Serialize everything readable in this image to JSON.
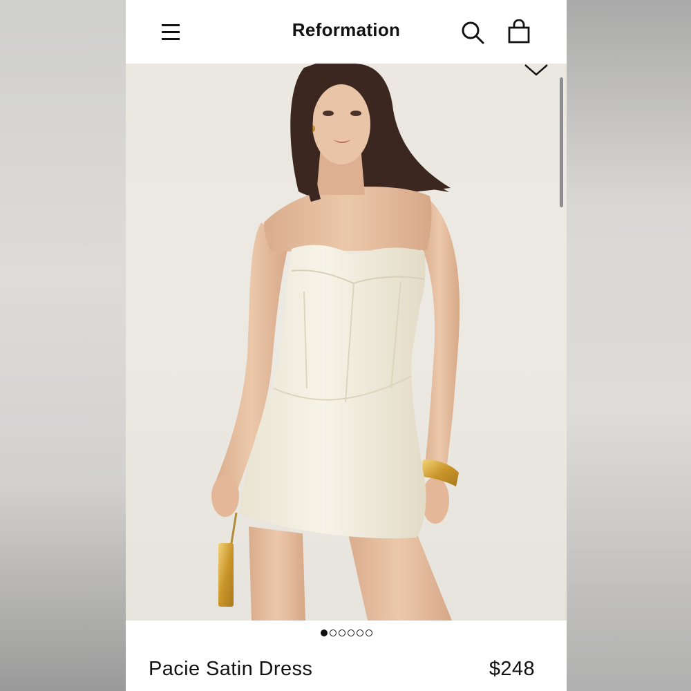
{
  "header": {
    "brand": "Reformation",
    "menu_icon": "hamburger-menu-icon",
    "search_icon": "search-icon",
    "bag_icon": "shopping-bag-icon"
  },
  "gallery": {
    "expand_icon": "chevron-down-icon",
    "image_subject": "model in white strapless satin corset mini dress",
    "total_images": 6,
    "active_index": 0
  },
  "product": {
    "name": "Pacie Satin Dress",
    "price": "$248"
  },
  "colors": {
    "background": "#ffffff",
    "text": "#111111",
    "photo_backdrop": "#ebe8e2",
    "dress": "#f3eee0",
    "skin": "#e8c2a4",
    "hair": "#3a2620",
    "gold": "#d4a634"
  }
}
